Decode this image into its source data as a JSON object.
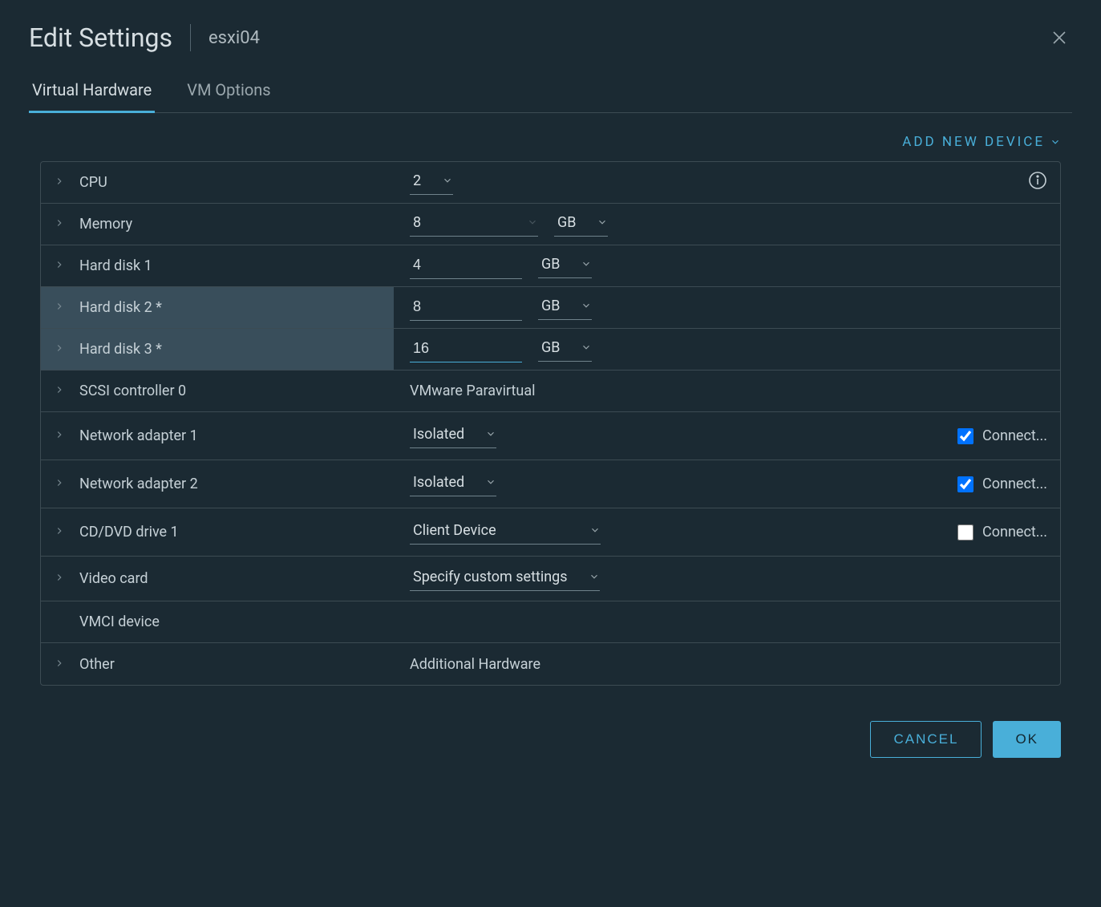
{
  "header": {
    "title": "Edit Settings",
    "subtitle": "esxi04"
  },
  "tabs": {
    "hardware": "Virtual Hardware",
    "options": "VM Options"
  },
  "toolbar": {
    "add_device": "ADD NEW DEVICE"
  },
  "rows": {
    "cpu": {
      "label": "CPU",
      "value": "2"
    },
    "memory": {
      "label": "Memory",
      "value": "8",
      "unit": "GB"
    },
    "hd1": {
      "label": "Hard disk 1",
      "value": "4",
      "unit": "GB"
    },
    "hd2": {
      "label": "Hard disk 2 *",
      "value": "8",
      "unit": "GB"
    },
    "hd3": {
      "label": "Hard disk 3 *",
      "value": "16",
      "unit": "GB"
    },
    "scsi": {
      "label": "SCSI controller 0",
      "value": "VMware Paravirtual"
    },
    "net1": {
      "label": "Network adapter 1",
      "value": "Isolated",
      "connect": "Connect..."
    },
    "net2": {
      "label": "Network adapter 2",
      "value": "Isolated",
      "connect": "Connect..."
    },
    "cd": {
      "label": "CD/DVD drive 1",
      "value": "Client Device",
      "connect": "Connect..."
    },
    "video": {
      "label": "Video card",
      "value": "Specify custom settings"
    },
    "vmci": {
      "label": "VMCI device"
    },
    "other": {
      "label": "Other",
      "value": "Additional Hardware"
    }
  },
  "footer": {
    "cancel": "CANCEL",
    "ok": "OK"
  }
}
